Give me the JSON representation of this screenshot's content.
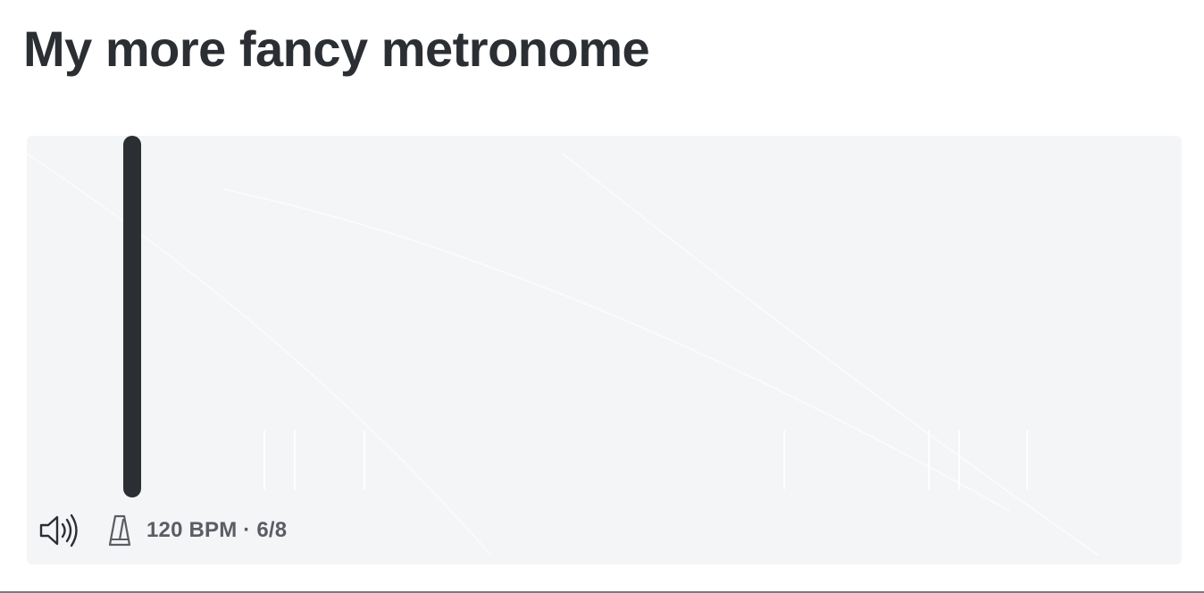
{
  "page": {
    "title": "My more fancy metronome"
  },
  "metronome": {
    "bpm": 120,
    "time_signature": "6/8",
    "readout": "120 BPM · 6/8",
    "pendulum_color": "#2b2e33",
    "panel_color": "#f4f5f7"
  },
  "controls": {
    "sound_icon": "speaker-volume-icon",
    "metronome_icon": "metronome-icon"
  }
}
